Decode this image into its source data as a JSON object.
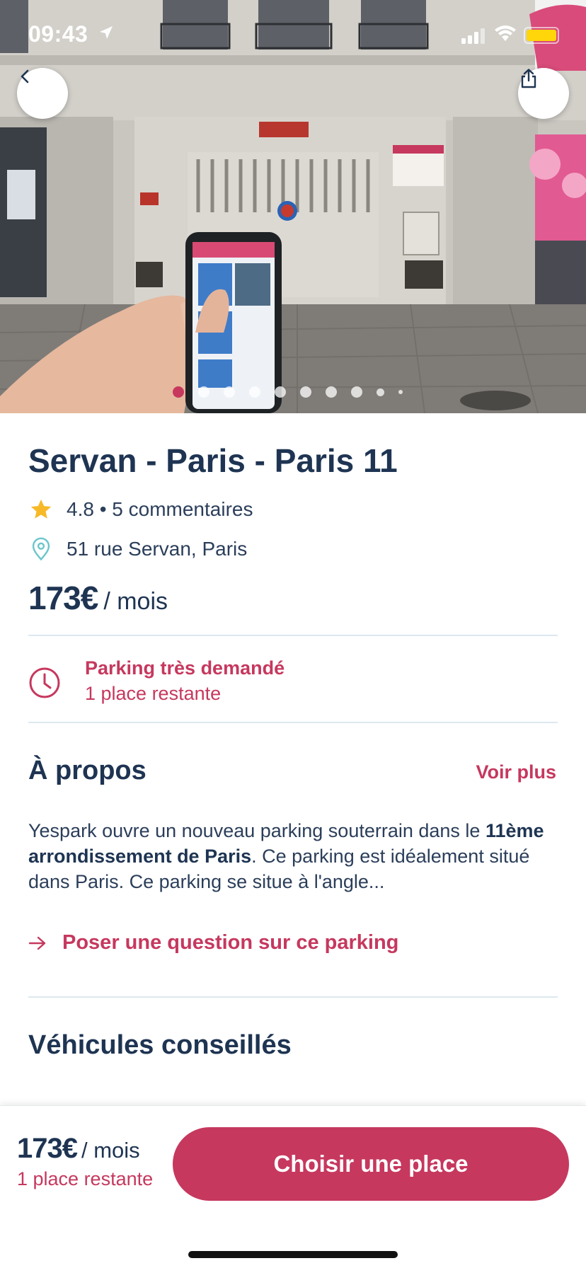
{
  "status_bar": {
    "time": "09:43"
  },
  "gallery": {
    "image_count": 10,
    "active_index": 0
  },
  "listing": {
    "title": "Servan - Paris - Paris 11",
    "rating_text": "4.8 • 5 commentaires",
    "address": "51 rue Servan, Paris",
    "price_amount": "173€",
    "price_unit": "/ mois"
  },
  "demand": {
    "title": "Parking très demandé",
    "subtitle": "1 place restante"
  },
  "about": {
    "heading": "À propos",
    "see_more": "Voir plus",
    "text_before": "Yespark ouvre un nouveau parking souterrain dans le ",
    "text_bold": "11ème arrondissement de Paris",
    "text_after": ". Ce parking est idéalement situé dans Paris. Ce parking se situe à l'angle..."
  },
  "ask_question": "Poser une question sur ce parking",
  "vehicles_heading": "Véhicules conseillés",
  "bottom_bar": {
    "price_amount": "173€",
    "price_unit": "/ mois",
    "remaining": "1 place restante",
    "cta_label": "Choisir une place"
  },
  "colors": {
    "accent": "#c6385e",
    "text_primary": "#1e3452",
    "star": "#f7b928",
    "location_icon": "#6cc6cc",
    "divider": "#dce8ef"
  },
  "icons": {
    "back": "chevron-left-icon",
    "share": "share-icon",
    "star": "star-icon",
    "location": "location-pin-icon",
    "clock": "clock-icon",
    "arrow": "arrow-right-icon"
  }
}
